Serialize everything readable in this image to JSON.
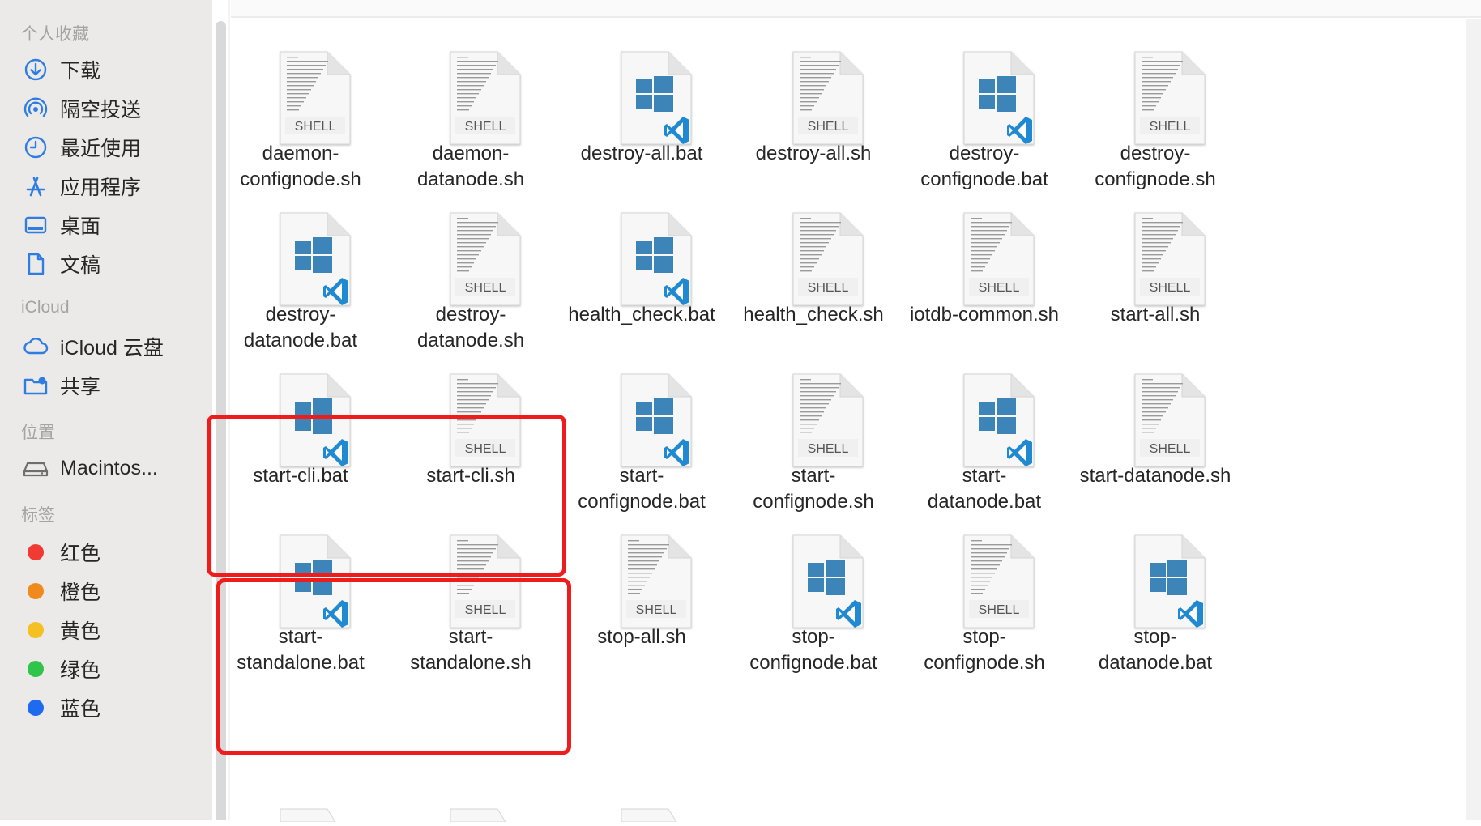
{
  "sidebar": {
    "favorites_title": "个人收藏",
    "favorites": [
      {
        "label": "下载",
        "icon": "download-icon"
      },
      {
        "label": "隔空投送",
        "icon": "airdrop-icon"
      },
      {
        "label": "最近使用",
        "icon": "clock-icon"
      },
      {
        "label": "应用程序",
        "icon": "applications-icon"
      },
      {
        "label": "桌面",
        "icon": "desktop-icon"
      },
      {
        "label": "文稿",
        "icon": "document-icon"
      }
    ],
    "icloud_title": "iCloud",
    "icloud": [
      {
        "label": "iCloud 云盘",
        "icon": "cloud-icon"
      },
      {
        "label": "共享",
        "icon": "shared-folder-icon"
      }
    ],
    "locations_title": "位置",
    "locations": [
      {
        "label": "Macintos...",
        "icon": "disk-icon"
      }
    ],
    "tags_title": "标签",
    "tags": [
      {
        "label": "红色",
        "color": "#f23a34"
      },
      {
        "label": "橙色",
        "color": "#f08a1c"
      },
      {
        "label": "黄色",
        "color": "#f5c024"
      },
      {
        "label": "绿色",
        "color": "#31c44a"
      },
      {
        "label": "蓝色",
        "color": "#1f6bf0"
      }
    ]
  },
  "files": [
    {
      "line1": "daemon-",
      "line2": "confignode.sh",
      "type": "sh"
    },
    {
      "line1": "daemon-",
      "line2": "datanode.sh",
      "type": "sh"
    },
    {
      "line1": "destroy-all.bat",
      "line2": "",
      "type": "bat"
    },
    {
      "line1": "destroy-all.sh",
      "line2": "",
      "type": "sh"
    },
    {
      "line1": "destroy-",
      "line2": "confignode.bat",
      "type": "bat"
    },
    {
      "line1": "destroy-",
      "line2": "confignode.sh",
      "type": "sh"
    },
    {
      "line1": "destroy-",
      "line2": "datanode.bat",
      "type": "bat"
    },
    {
      "line1": "destroy-",
      "line2": "datanode.sh",
      "type": "sh"
    },
    {
      "line1": "health_check.bat",
      "line2": "",
      "type": "bat"
    },
    {
      "line1": "health_check.sh",
      "line2": "",
      "type": "sh"
    },
    {
      "line1": "iotdb-common.sh",
      "line2": "",
      "type": "sh"
    },
    {
      "line1": "start-all.sh",
      "line2": "",
      "type": "sh"
    },
    {
      "line1": "start-cli.bat",
      "line2": "",
      "type": "bat"
    },
    {
      "line1": "start-cli.sh",
      "line2": "",
      "type": "sh"
    },
    {
      "line1": "start-",
      "line2": "confignode.bat",
      "type": "bat"
    },
    {
      "line1": "start-",
      "line2": "confignode.sh",
      "type": "sh"
    },
    {
      "line1": "start-",
      "line2": "datanode.bat",
      "type": "bat"
    },
    {
      "line1": "start-datanode.sh",
      "line2": "",
      "type": "sh"
    },
    {
      "line1": "start-",
      "line2": "standalone.bat",
      "type": "bat"
    },
    {
      "line1": "start-",
      "line2": "standalone.sh",
      "type": "sh"
    },
    {
      "line1": "stop-all.sh",
      "line2": "",
      "type": "sh"
    },
    {
      "line1": "stop-",
      "line2": "confignode.bat",
      "type": "bat"
    },
    {
      "line1": "stop-",
      "line2": "confignode.sh",
      "type": "sh"
    },
    {
      "line1": "stop-",
      "line2": "datanode.bat",
      "type": "bat"
    }
  ],
  "shell_badge": "SHELL",
  "colors": {
    "highlight": "#ef1c1c",
    "windows_logo": "#3d85b8",
    "vscode": "#1f8ad2"
  }
}
